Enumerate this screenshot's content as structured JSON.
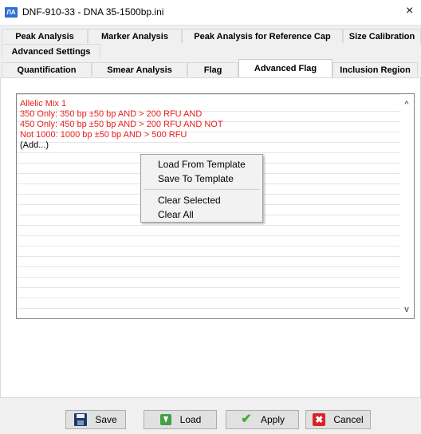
{
  "window": {
    "title": "DNF-910-33 - DNA 35-1500bp.ini",
    "icon": "app-icon",
    "icon_text": "ЛА",
    "close_glyph": "×"
  },
  "tabs": {
    "row1": [
      "Peak Analysis",
      "Marker Analysis",
      "Peak Analysis for Reference Cap",
      "Size Calibration"
    ],
    "row2": [
      "Advanced Settings"
    ],
    "row3": [
      "Quantification",
      "Smear Analysis",
      "Flag",
      "Advanced Flag",
      "Inclusion Region"
    ],
    "active": "Advanced Flag"
  },
  "list": {
    "items": [
      "Allelic Mix 1",
      "350 Only: 350 bp ±50 bp AND > 200 RFU AND",
      "450 Only: 450 bp ±50 bp AND > 200 RFU AND NOT",
      "Not 1000: 1000 bp ±50 bp AND > 500 RFU",
      "(Add...)"
    ],
    "item_color": "#e8201d",
    "scroll_up_glyph": "^",
    "scroll_down_glyph": "v"
  },
  "context_menu": {
    "items": [
      "Load From Template",
      "Save To Template",
      "Clear Selected",
      "Clear All"
    ]
  },
  "buttons": {
    "save": "Save",
    "load": "Load",
    "apply": "Apply",
    "cancel": "Cancel",
    "apply_glyph": "✔",
    "cancel_glyph": "✖"
  }
}
